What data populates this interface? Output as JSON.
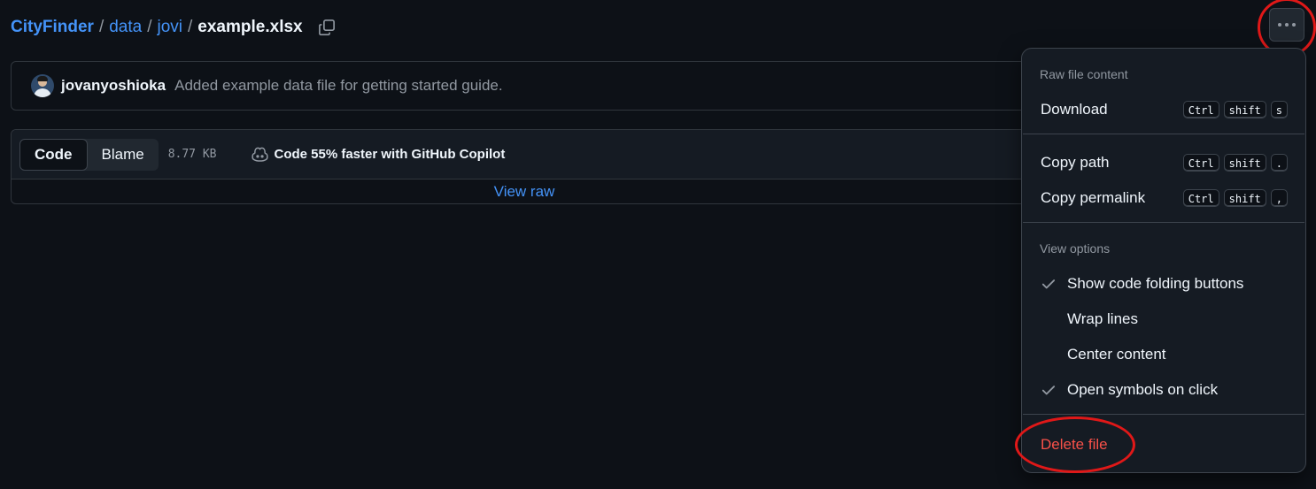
{
  "breadcrumb": {
    "repo": "CityFinder",
    "folders": [
      "data",
      "jovi"
    ],
    "separator": "/",
    "file": "example.xlsx"
  },
  "commit": {
    "author": "jovanyoshioka",
    "message": "Added example data file for getting started guide."
  },
  "file_header": {
    "tabs": [
      {
        "label": "Code",
        "active": true
      },
      {
        "label": "Blame",
        "active": false
      }
    ],
    "size": "8.77 KB",
    "copilot_text": "Code 55% faster with GitHub Copilot",
    "view_raw": "View raw"
  },
  "menu": {
    "raw_title": "Raw file content",
    "download": {
      "label": "Download",
      "keys": [
        "Ctrl",
        "shift",
        "s"
      ]
    },
    "copy_path": {
      "label": "Copy path",
      "keys": [
        "Ctrl",
        "shift",
        "."
      ]
    },
    "copy_permalink": {
      "label": "Copy permalink",
      "keys": [
        "Ctrl",
        "shift",
        ","
      ]
    },
    "view_options_title": "View options",
    "view_options": [
      {
        "label": "Show code folding buttons",
        "checked": true
      },
      {
        "label": "Wrap lines",
        "checked": false
      },
      {
        "label": "Center content",
        "checked": false
      },
      {
        "label": "Open symbols on click",
        "checked": true
      }
    ],
    "delete": "Delete file"
  },
  "colors": {
    "background": "#0d1117",
    "link": "#4493f8",
    "danger": "#f85149",
    "annotation": "#e01818"
  },
  "icons": {
    "copy": "copy-icon",
    "copilot": "copilot-icon",
    "more": "kebab-horizontal-icon",
    "check": "check-icon"
  }
}
